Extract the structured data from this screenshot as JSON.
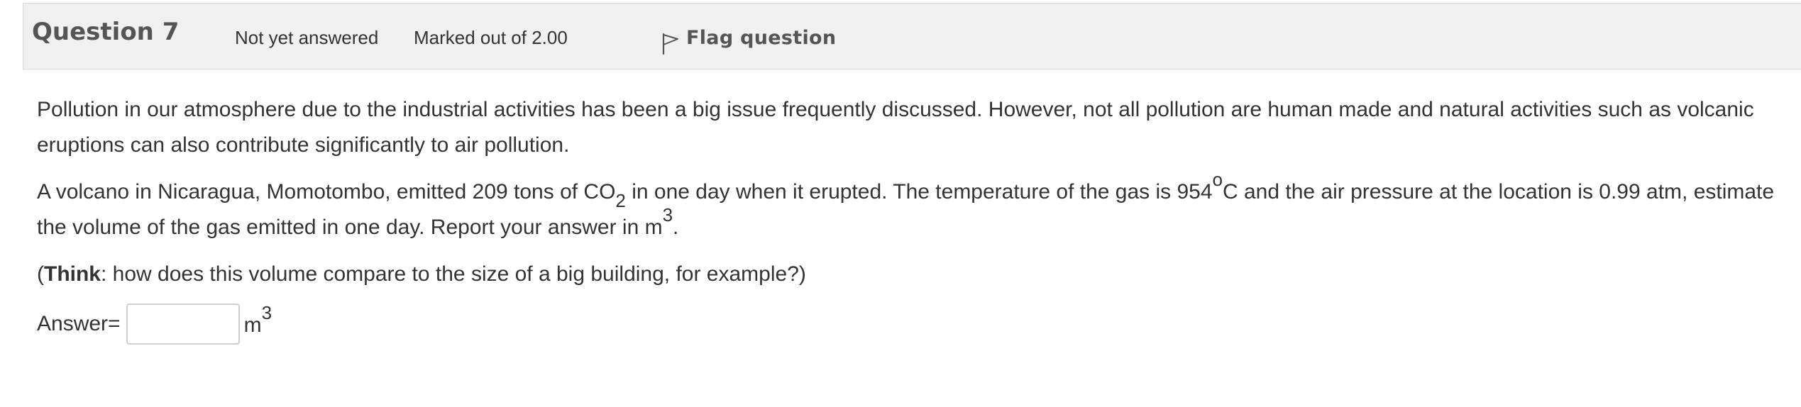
{
  "header": {
    "question_no": "Question 7",
    "state": "Not yet answered",
    "grade": "Marked out of 2.00",
    "flag_icon": "flag-icon",
    "flag_label": "Flag question"
  },
  "content": {
    "p1": "Pollution in our atmosphere due to the industrial activities has been a big issue frequently discussed.  However, not all pollution are human made and natural activities such as volcanic eruptions can also contribute significantly to air pollution.",
    "p2": {
      "before_co": "A volcano in Nicaragua, Momotombo, emitted 209 tons of CO",
      "co_sub": "2",
      "after_co": " in one day when it erupted.  The temperature of the gas is 954",
      "deg_sup": "o",
      "after_deg": "C and the air pressure at the location is 0.99 atm, estimate the volume of the gas emitted in one day.  Report your answer in m",
      "m_sup": "3",
      "end": "."
    },
    "p3": {
      "open": "(",
      "think": "Think",
      "rest": ": how does this volume compare to the size of a big building, for example?)"
    },
    "answer": {
      "label": "Answer=",
      "value": "",
      "unit": "m",
      "unit_sup": "3"
    }
  }
}
